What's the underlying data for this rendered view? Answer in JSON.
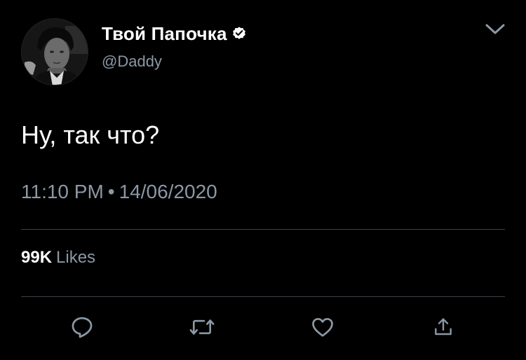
{
  "tweet": {
    "author": {
      "display_name": "Твой Папочка",
      "handle": "@Daddy",
      "verified": true,
      "avatar_icon": "profile-photo"
    },
    "text": "Ну, так что?",
    "time": "11:10 PM",
    "separator": "•",
    "date": "14/06/2020",
    "stats": {
      "likes_count": "99K",
      "likes_label": "Likes"
    },
    "actions": {
      "reply_icon": "reply-icon",
      "retweet_icon": "retweet-icon",
      "like_icon": "heart-icon",
      "share_icon": "share-icon"
    },
    "menu_icon": "chevron-down-icon"
  },
  "colors": {
    "background": "#000000",
    "primary_text": "#ffffff",
    "secondary_text": "#8b98a5",
    "divider": "#3d4147"
  }
}
